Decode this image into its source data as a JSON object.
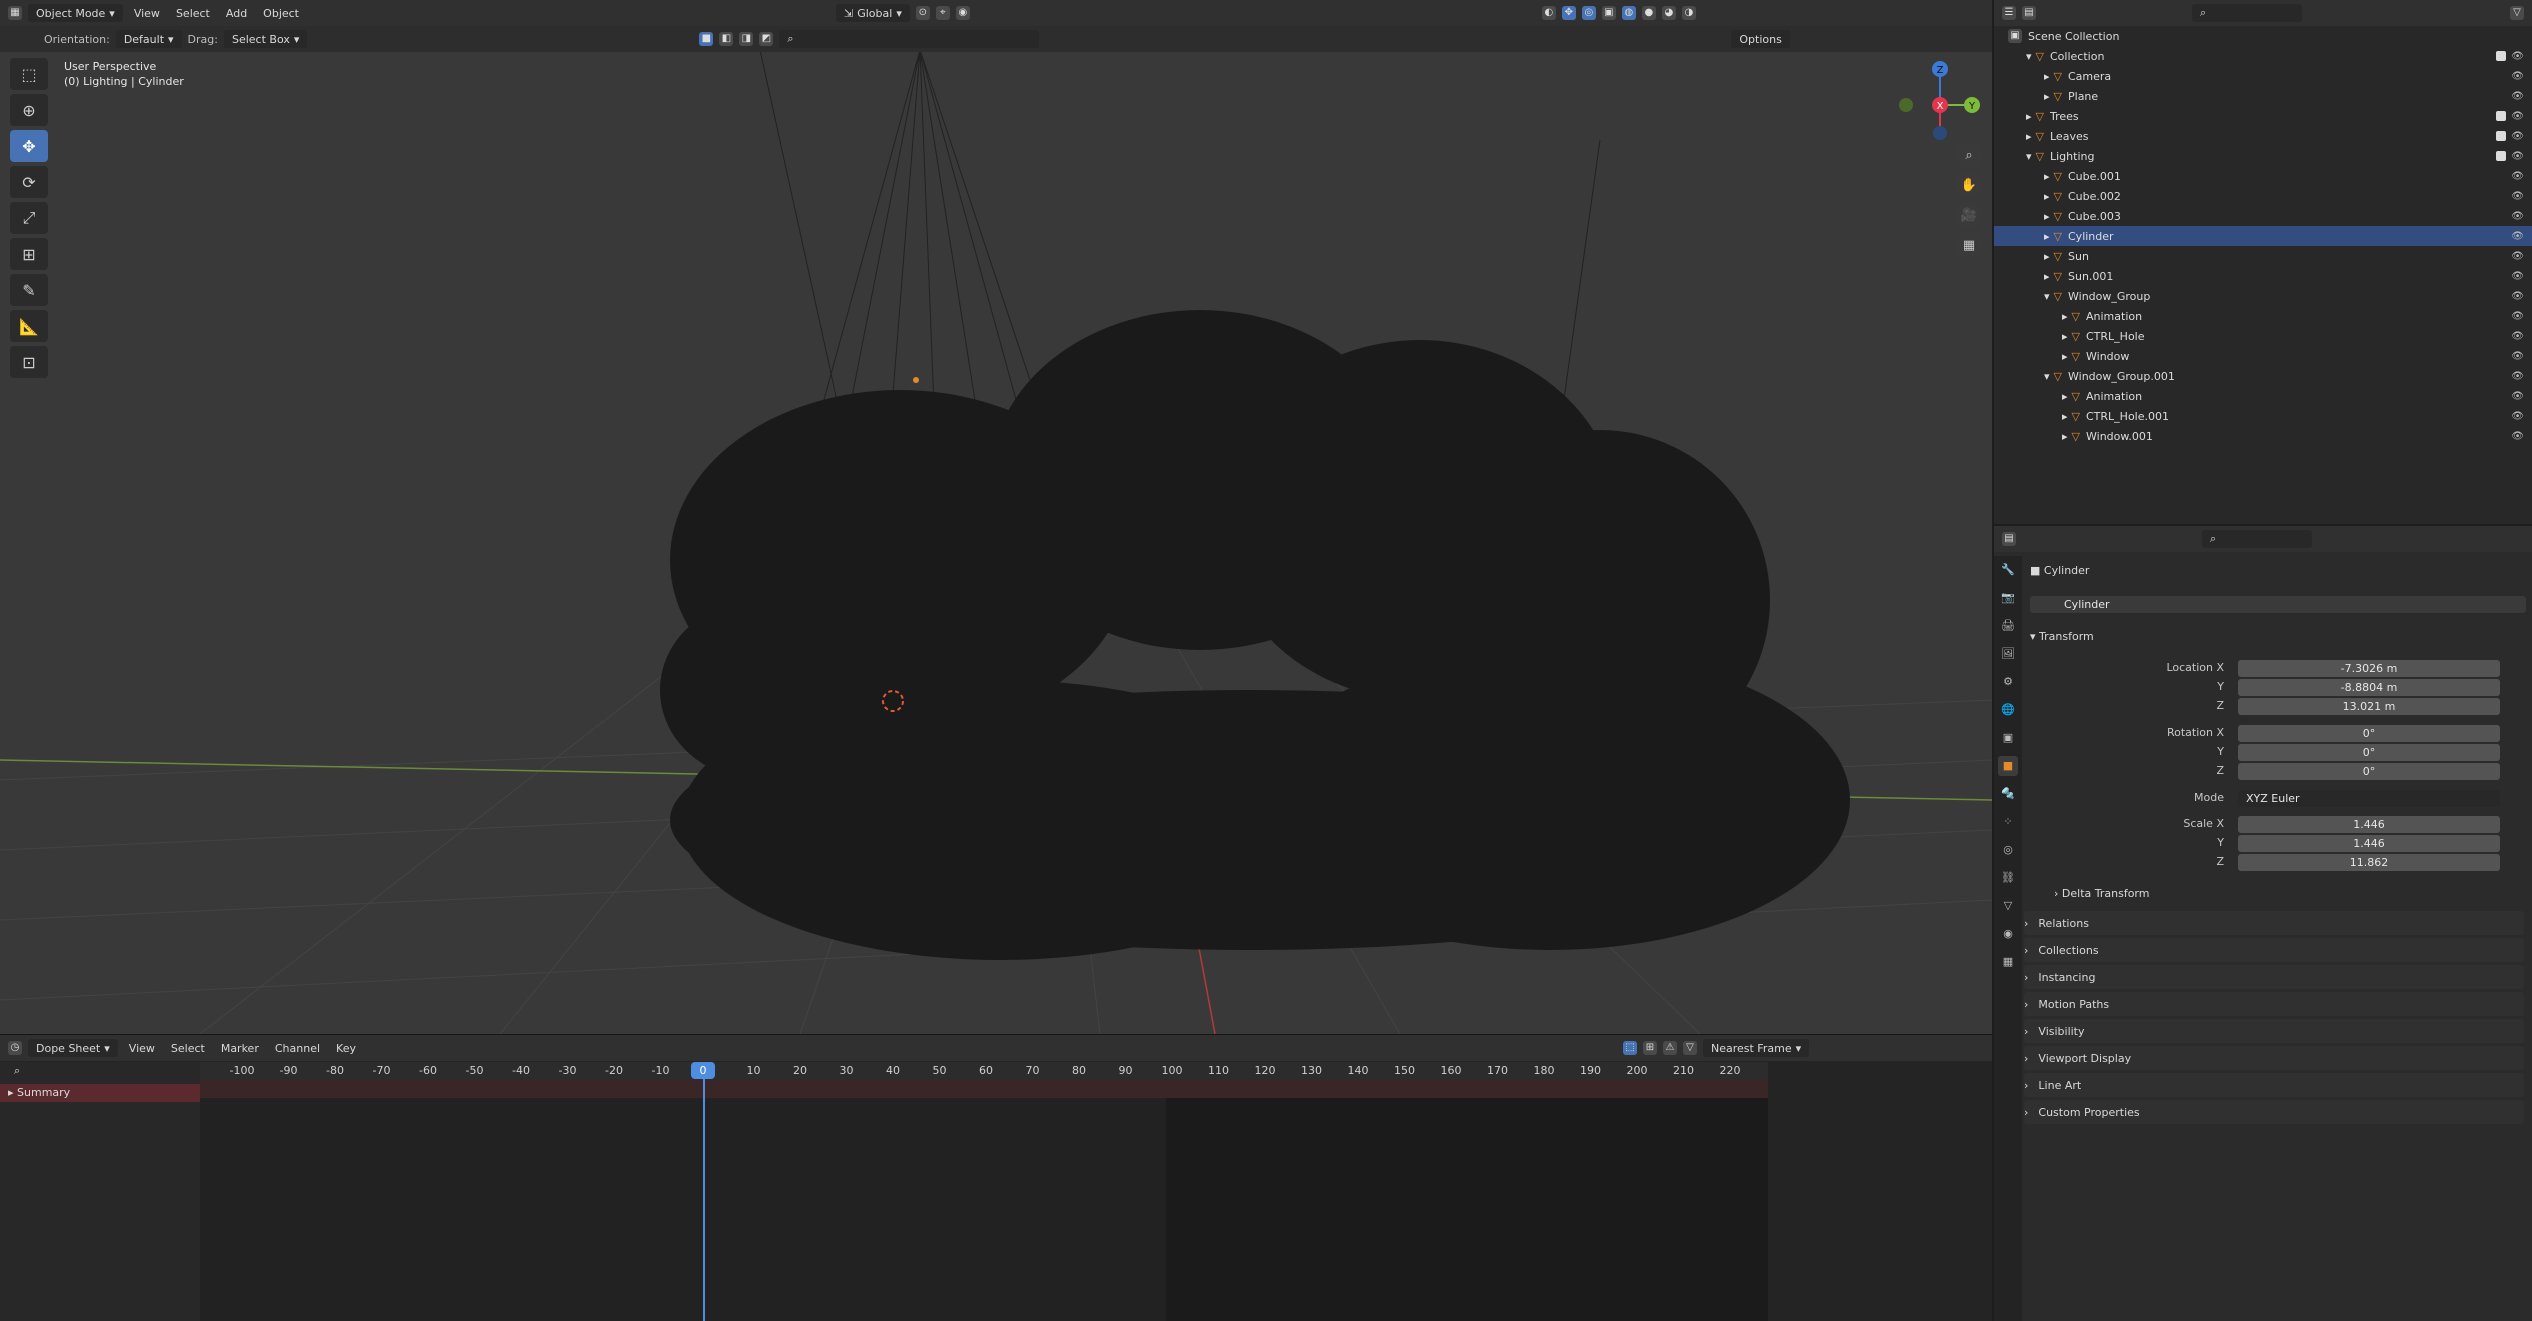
{
  "viewport_header": {
    "mode": "Object Mode",
    "menus": [
      "View",
      "Select",
      "Add",
      "Object"
    ],
    "transform": "Global",
    "orientation_label": "Orientation:",
    "orientation_value": "Default",
    "drag_label": "Drag:",
    "drag_value": "Select Box",
    "options": "Options"
  },
  "viewport": {
    "perspective": "User Perspective",
    "context": "(0) Lighting | Cylinder",
    "gizmo": {
      "x": "X",
      "y": "Y",
      "z": "Z"
    }
  },
  "tools": [
    "select-box",
    "cursor",
    "move",
    "rotate",
    "scale",
    "transform",
    "annotate",
    "measure",
    "add-cube"
  ],
  "outliner": {
    "root": "Scene Collection",
    "rows": [
      {
        "label": "Collection",
        "indent": 1,
        "expanded": true,
        "check": true
      },
      {
        "label": "Camera",
        "indent": 2
      },
      {
        "label": "Plane",
        "indent": 2
      },
      {
        "label": "Trees",
        "indent": 1,
        "check": true
      },
      {
        "label": "Leaves",
        "indent": 1,
        "check": true
      },
      {
        "label": "Lighting",
        "indent": 1,
        "expanded": true,
        "check": true
      },
      {
        "label": "Cube.001",
        "indent": 2
      },
      {
        "label": "Cube.002",
        "indent": 2
      },
      {
        "label": "Cube.003",
        "indent": 2
      },
      {
        "label": "Cylinder",
        "indent": 2,
        "selected": true
      },
      {
        "label": "Sun",
        "indent": 2
      },
      {
        "label": "Sun.001",
        "indent": 2
      },
      {
        "label": "Window_Group",
        "indent": 2,
        "expanded": true
      },
      {
        "label": "Animation",
        "indent": 3
      },
      {
        "label": "CTRL_Hole",
        "indent": 3
      },
      {
        "label": "Window",
        "indent": 3
      },
      {
        "label": "Window_Group.001",
        "indent": 2,
        "expanded": true
      },
      {
        "label": "Animation",
        "indent": 3
      },
      {
        "label": "CTRL_Hole.001",
        "indent": 3
      },
      {
        "label": "Window.001",
        "indent": 3
      }
    ]
  },
  "properties": {
    "object_name": "Cylinder",
    "object_field": "Cylinder",
    "transform_title": "Transform",
    "location": {
      "label": "Location X",
      "x": "-7.3026 m",
      "y": "-8.8804 m",
      "z": "13.021 m"
    },
    "rotation": {
      "label": "Rotation X",
      "x": "0°",
      "y": "0°",
      "z": "0°"
    },
    "mode_label": "Mode",
    "mode_value": "XYZ Euler",
    "scale": {
      "label": "Scale X",
      "x": "1.446",
      "y": "1.446",
      "z": "11.862"
    },
    "axis_y": "Y",
    "axis_z": "Z",
    "delta": "Delta Transform",
    "panels": [
      "Relations",
      "Collections",
      "Instancing",
      "Motion Paths",
      "Visibility",
      "Viewport Display",
      "Line Art",
      "Custom Properties"
    ]
  },
  "dope_sheet": {
    "editor": "Dope Sheet",
    "menus": [
      "View",
      "Select",
      "Marker",
      "Channel",
      "Key"
    ],
    "snap": "Nearest Frame",
    "current_frame": "0",
    "channel": "Summary",
    "ticks": [
      "-100",
      "-90",
      "-80",
      "-70",
      "-60",
      "-50",
      "-40",
      "-30",
      "-20",
      "-10",
      "0",
      "10",
      "20",
      "30",
      "40",
      "50",
      "60",
      "70",
      "80",
      "90",
      "100",
      "110",
      "120",
      "130",
      "140",
      "150",
      "160",
      "170",
      "180",
      "190",
      "200",
      "210",
      "220"
    ]
  }
}
